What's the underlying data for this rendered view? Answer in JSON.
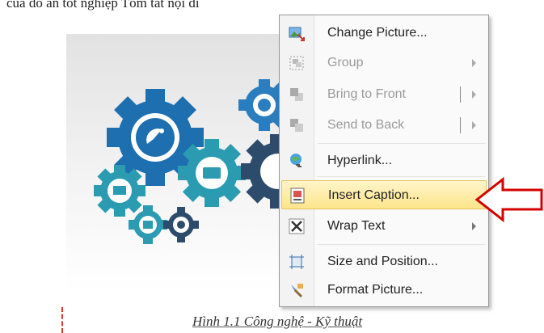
{
  "document": {
    "top_text": "của đồ án tốt nghiệp Tóm tắt nội di",
    "caption": "Hình 1.1 Công nghệ - Kỹ thuật"
  },
  "context_menu": {
    "items": [
      {
        "label": "Change Picture...",
        "icon": "change-picture-icon",
        "enabled": true
      },
      {
        "label": "Group",
        "icon": "group-icon",
        "enabled": false,
        "submenu": true
      },
      {
        "label": "Bring to Front",
        "icon": "bring-to-front-icon",
        "enabled": false,
        "submenu": true
      },
      {
        "label": "Send to Back",
        "icon": "send-to-back-icon",
        "enabled": false,
        "submenu": true
      },
      {
        "label": "Hyperlink...",
        "icon": "hyperlink-icon",
        "enabled": true
      },
      {
        "label": "Insert Caption...",
        "icon": "insert-caption-icon",
        "enabled": true,
        "highlighted": true
      },
      {
        "label": "Wrap Text",
        "icon": "wrap-text-icon",
        "enabled": true,
        "submenu": true
      },
      {
        "label": "Size and Position...",
        "icon": "size-position-icon",
        "enabled": true
      },
      {
        "label": "Format Picture...",
        "icon": "format-picture-icon",
        "enabled": true
      }
    ]
  },
  "colors": {
    "gear_blue": "#1d6fb0",
    "gear_teal": "#2a9bb1",
    "gear_dark": "#2d4b6a",
    "highlight": "#fde58c",
    "pointer_red": "#d40000"
  }
}
